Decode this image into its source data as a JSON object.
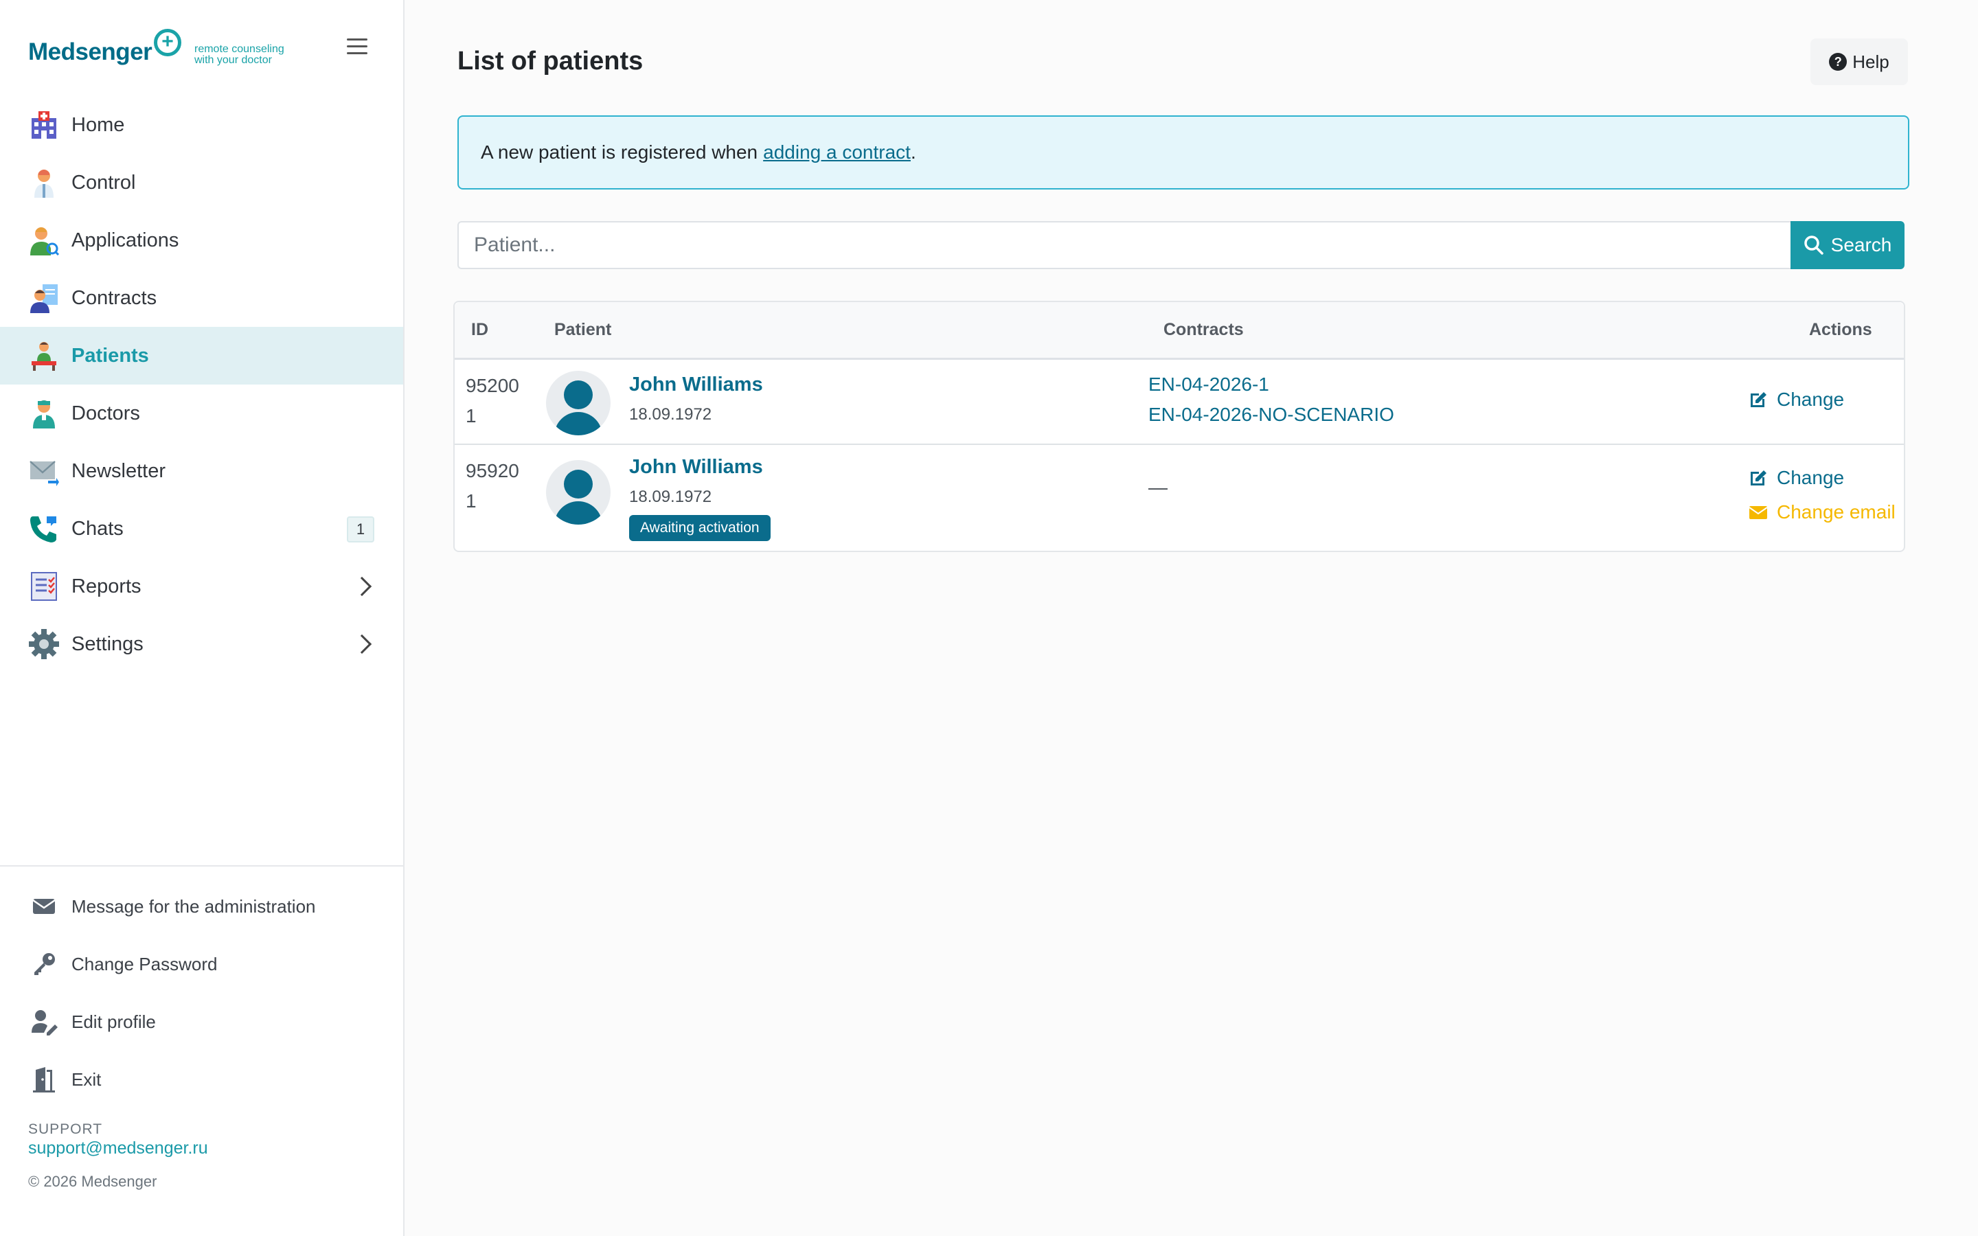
{
  "brand": {
    "name": "Medsenger",
    "tagline_line1": "remote counseling",
    "tagline_line2": "with your doctor"
  },
  "nav": [
    {
      "label": "Home",
      "icon": "hospital-icon",
      "active": false
    },
    {
      "label": "Control",
      "icon": "doctor-icon",
      "active": false
    },
    {
      "label": "Applications",
      "icon": "applications-icon",
      "active": false
    },
    {
      "label": "Contracts",
      "icon": "contracts-icon",
      "active": false
    },
    {
      "label": "Patients",
      "icon": "patients-icon",
      "active": true
    },
    {
      "label": "Doctors",
      "icon": "doctors-icon",
      "active": false
    },
    {
      "label": "Newsletter",
      "icon": "newsletter-icon",
      "active": false
    },
    {
      "label": "Chats",
      "icon": "phone-icon",
      "active": false,
      "badge": "1"
    },
    {
      "label": "Reports",
      "icon": "report-icon",
      "active": false,
      "has_submenu": true
    },
    {
      "label": "Settings",
      "icon": "gear-icon",
      "active": false,
      "has_submenu": true
    }
  ],
  "bottom_nav": [
    {
      "label": "Message for the administration",
      "icon": "envelope-icon"
    },
    {
      "label": "Change Password",
      "icon": "key-icon"
    },
    {
      "label": "Edit profile",
      "icon": "user-edit-icon"
    },
    {
      "label": "Exit",
      "icon": "door-exit-icon"
    }
  ],
  "support": {
    "label": "SUPPORT",
    "email": "support@medsenger.ru",
    "copyright": "© 2026 Medsenger"
  },
  "main": {
    "title": "List of patients",
    "help_label": "Help",
    "alert_text": "A new patient is registered when",
    "alert_link": "adding a contract",
    "alert_end": ".",
    "search_placeholder": "Patient...",
    "search_label": "Search"
  },
  "table": {
    "headers": {
      "id": "ID",
      "patient": "Patient",
      "contracts": "Contracts",
      "actions": "Actions"
    },
    "rows": [
      {
        "id": "952001",
        "name": "John Williams",
        "dob": "18.09.1972",
        "contracts": [
          "EN-04-2026-1",
          "EN-04-2026-NO-SCENARIO"
        ],
        "actions": [
          "Change"
        ]
      },
      {
        "id": "959201",
        "name": "John Williams",
        "dob": "18.09.1972",
        "status": "Awaiting activation",
        "contracts_empty": "—",
        "actions": [
          "Change",
          "Change email"
        ]
      }
    ]
  },
  "colors": {
    "brand_dark": "#006c88",
    "accent_teal": "#1a9aa8",
    "link": "#0a6c8c",
    "warning": "#f5b800",
    "alert_bg": "#e4f6fb",
    "active_nav_bg": "#e0f0f3"
  }
}
